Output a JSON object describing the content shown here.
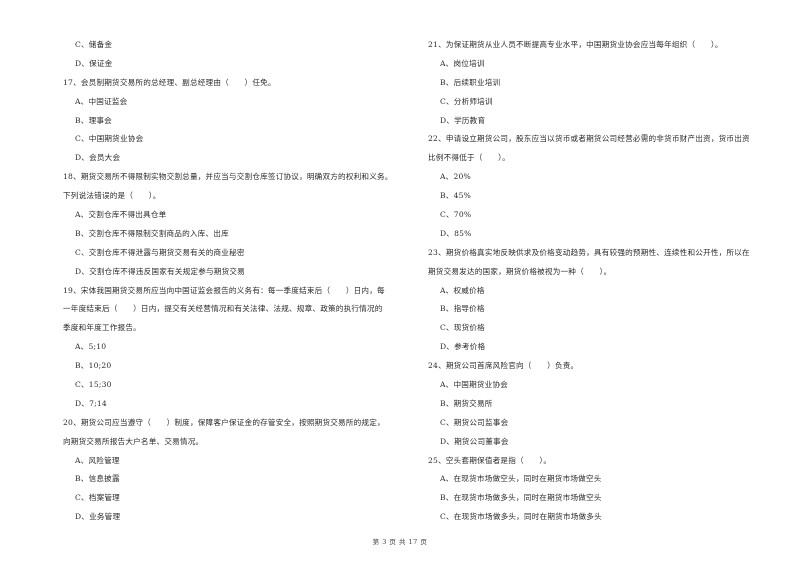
{
  "left_column": [
    {
      "type": "option",
      "text": "C、储备金"
    },
    {
      "type": "option",
      "text": "D、保证金"
    },
    {
      "type": "question",
      "text": "17、会员制期货交易所的总经理、副总经理由（　　）任免。"
    },
    {
      "type": "option",
      "text": "A、中国证监会"
    },
    {
      "type": "option",
      "text": "B、理事会"
    },
    {
      "type": "option",
      "text": "C、中国期货业协会"
    },
    {
      "type": "option",
      "text": "D、会员大会"
    },
    {
      "type": "question",
      "text": "18、期货交易所不得限制实物交割总量，并应当与交割仓库签订协议，明确双方的权利和义务。"
    },
    {
      "type": "question",
      "text": "下列说法错误的是（　　）。"
    },
    {
      "type": "option",
      "text": "A、交割仓库不得出具仓单"
    },
    {
      "type": "option",
      "text": "B、交割仓库不得限制交割商品的入库、出库"
    },
    {
      "type": "option",
      "text": "C、交割仓库不得泄露与期货交易有关的商业秘密"
    },
    {
      "type": "option",
      "text": "D、交割仓库不得违反国家有关规定参与期货交易"
    },
    {
      "type": "question",
      "text": "19、宋体我国期货交易所应当向中国证监会报告的义务有：每一季度结束后（　　）日内，每"
    },
    {
      "type": "question",
      "text": "一年度结束后（　　）日内，提交有关经营情况和有关法律、法规、规章、政策的执行情况的"
    },
    {
      "type": "question",
      "text": "季度和年度工作报告。"
    },
    {
      "type": "option",
      "text": "A、5;10"
    },
    {
      "type": "option",
      "text": "B、10;20"
    },
    {
      "type": "option",
      "text": "C、15;30"
    },
    {
      "type": "option",
      "text": "D、7;14"
    },
    {
      "type": "question",
      "text": "20、期货公司应当遵守（　　）制度，保障客户保证金的存管安全，按照期货交易所的规定，"
    },
    {
      "type": "question",
      "text": "向期货交易所报告大户名单、交易情况。"
    },
    {
      "type": "option",
      "text": "A、风险管理"
    },
    {
      "type": "option",
      "text": "B、信息披露"
    },
    {
      "type": "option",
      "text": "C、档案管理"
    },
    {
      "type": "option",
      "text": "D、业务管理"
    }
  ],
  "right_column": [
    {
      "type": "question",
      "text": "21、为保证期货从业人员不断提高专业水平，中国期货业协会应当每年组织（　　）。"
    },
    {
      "type": "option",
      "text": "A、岗位培训"
    },
    {
      "type": "option",
      "text": "B、后续职业培训"
    },
    {
      "type": "option",
      "text": "C、分析师培训"
    },
    {
      "type": "option",
      "text": "D、学历教育"
    },
    {
      "type": "question",
      "text": "22、申请设立期货公司，股东应当以货币或者期货公司经营必需的非货币财产出资，货币出资"
    },
    {
      "type": "question",
      "text": "比例不得低于（　　）。"
    },
    {
      "type": "option",
      "text": "A、20%"
    },
    {
      "type": "option",
      "text": "B、45%"
    },
    {
      "type": "option",
      "text": "C、70%"
    },
    {
      "type": "option",
      "text": "D、85%"
    },
    {
      "type": "question",
      "text": "23、期货价格真实地反映供求及价格变动趋势，具有较强的预期性、连续性和公开性，所以在"
    },
    {
      "type": "question",
      "text": "期货交易发达的国家，期货价格被视为一种（　　）。"
    },
    {
      "type": "option",
      "text": "A、权威价格"
    },
    {
      "type": "option",
      "text": "B、指导价格"
    },
    {
      "type": "option",
      "text": "C、现货价格"
    },
    {
      "type": "option",
      "text": "D、参考价格"
    },
    {
      "type": "question",
      "text": "24、期货公司首席风险官向（　　）负责。"
    },
    {
      "type": "option",
      "text": "A、中国期货业协会"
    },
    {
      "type": "option",
      "text": "B、期货交易所"
    },
    {
      "type": "option",
      "text": "C、期货公司监事会"
    },
    {
      "type": "option",
      "text": "D、期货公司董事会"
    },
    {
      "type": "question",
      "text": "25、空头套期保值者是指（　　）。"
    },
    {
      "type": "option",
      "text": "A、在现货市场做空头，同时在期货市场做空头"
    },
    {
      "type": "option",
      "text": "B、在现货市场做多头，同时在期货市场做空头"
    },
    {
      "type": "option",
      "text": "C、在现货市场做多头，同时在期货市场做多头"
    }
  ],
  "footer": {
    "page_label": "第 3 页 共 17 页"
  }
}
